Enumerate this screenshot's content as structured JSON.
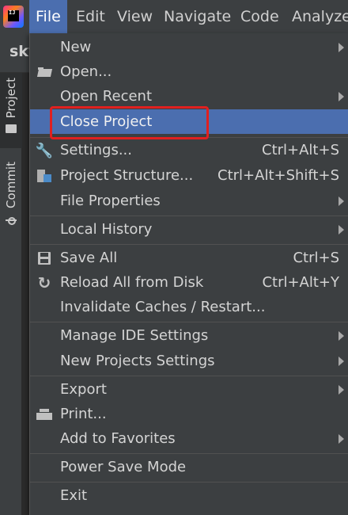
{
  "menubar": {
    "items": [
      {
        "label": "File"
      },
      {
        "label": "Edit"
      },
      {
        "label": "View"
      },
      {
        "label": "Navigate"
      },
      {
        "label": "Code"
      },
      {
        "label": "Analyze"
      }
    ],
    "logo_text": "IJ"
  },
  "background": {
    "project_name_fragment": "sky",
    "tabs": [
      {
        "label": "Project"
      },
      {
        "label": "Commit"
      }
    ]
  },
  "file_menu": {
    "items": [
      {
        "label": "New",
        "shortcut": "",
        "submenu": true,
        "icon": ""
      },
      {
        "label": "Open...",
        "shortcut": "",
        "submenu": false,
        "icon": "folder-icon"
      },
      {
        "label": "Open Recent",
        "shortcut": "",
        "submenu": true,
        "icon": ""
      },
      {
        "label": "Close Project",
        "shortcut": "",
        "submenu": false,
        "icon": "",
        "selected": true
      },
      {
        "label": "Settings...",
        "shortcut": "Ctrl+Alt+S",
        "submenu": false,
        "icon": "wrench-icon"
      },
      {
        "label": "Project Structure...",
        "shortcut": "Ctrl+Alt+Shift+S",
        "submenu": false,
        "icon": "project-structure-icon"
      },
      {
        "label": "File Properties",
        "shortcut": "",
        "submenu": true,
        "icon": ""
      },
      {
        "label": "Local History",
        "shortcut": "",
        "submenu": true,
        "icon": ""
      },
      {
        "label": "Save All",
        "shortcut": "Ctrl+S",
        "submenu": false,
        "icon": "save-icon"
      },
      {
        "label": "Reload All from Disk",
        "shortcut": "Ctrl+Alt+Y",
        "submenu": false,
        "icon": "reload-icon"
      },
      {
        "label": "Invalidate Caches / Restart...",
        "shortcut": "",
        "submenu": false,
        "icon": ""
      },
      {
        "label": "Manage IDE Settings",
        "shortcut": "",
        "submenu": true,
        "icon": ""
      },
      {
        "label": "New Projects Settings",
        "shortcut": "",
        "submenu": true,
        "icon": ""
      },
      {
        "label": "Export",
        "shortcut": "",
        "submenu": true,
        "icon": ""
      },
      {
        "label": "Print...",
        "shortcut": "",
        "submenu": false,
        "icon": "print-icon"
      },
      {
        "label": "Add to Favorites",
        "shortcut": "",
        "submenu": true,
        "icon": ""
      },
      {
        "label": "Power Save Mode",
        "shortcut": "",
        "submenu": false,
        "icon": ""
      },
      {
        "label": "Exit",
        "shortcut": "",
        "submenu": false,
        "icon": ""
      }
    ]
  },
  "colors": {
    "selection": "#4b6eaf",
    "highlight_box": "#e02020",
    "menu_bg": "#3c3f41"
  }
}
